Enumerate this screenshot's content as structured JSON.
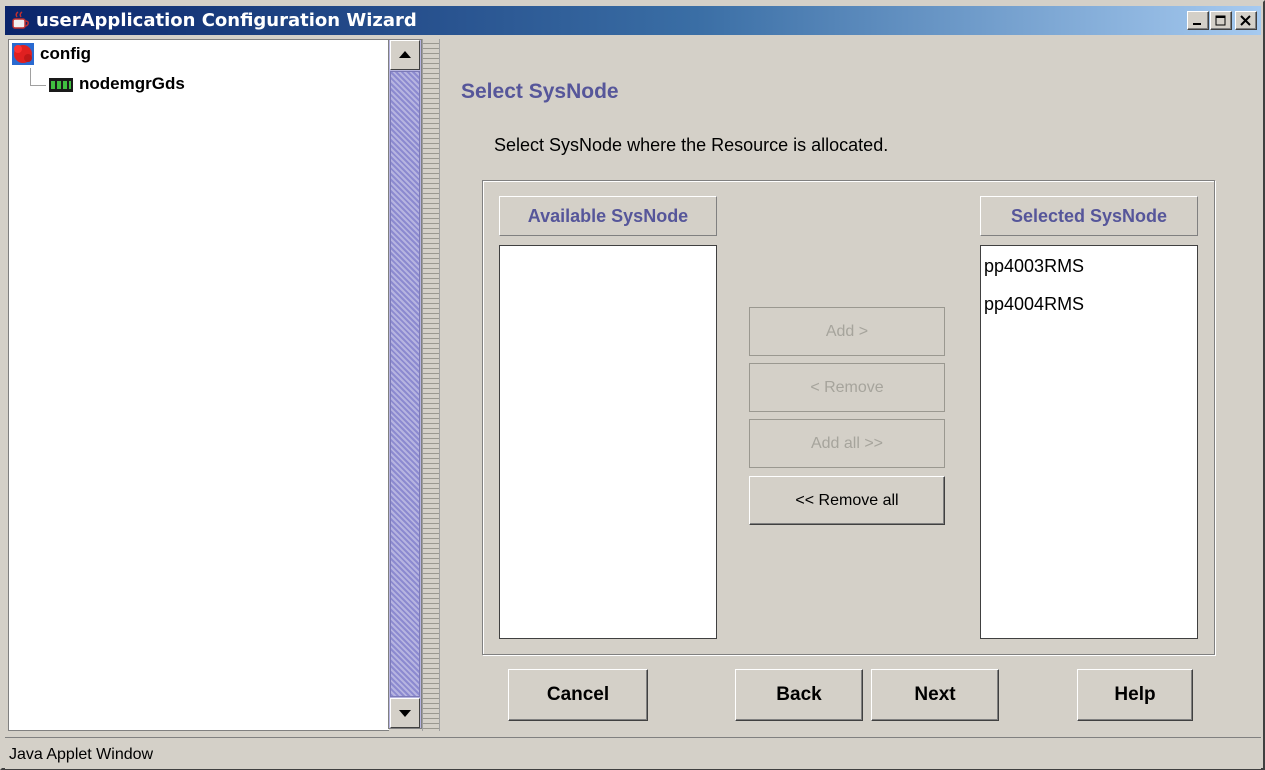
{
  "window": {
    "title": "userApplication Configuration Wizard",
    "status_text": "Java Applet Window"
  },
  "tree": {
    "root": {
      "label": "config",
      "icon": "config-icon"
    },
    "child": {
      "label": "nodemgrGds",
      "icon": "node-manager-icon"
    }
  },
  "page": {
    "heading": "Select SysNode",
    "instruction": "Select SysNode where the Resource is allocated."
  },
  "available": {
    "header": "Available SysNode",
    "items": []
  },
  "selected": {
    "header": "Selected SysNode",
    "items": [
      "pp4003RMS",
      "pp4004RMS"
    ]
  },
  "move_buttons": {
    "add": "Add >",
    "remove": "< Remove",
    "add_all": "Add all >>",
    "remove_all": "<< Remove all"
  },
  "nav_buttons": {
    "cancel": "Cancel",
    "back": "Back",
    "next": "Next",
    "help": "Help"
  },
  "colors": {
    "title_bar": "#0a246a",
    "heading": "#56569a",
    "face": "#d4d0c8",
    "scrollbar_track": "#b6b4e0"
  }
}
